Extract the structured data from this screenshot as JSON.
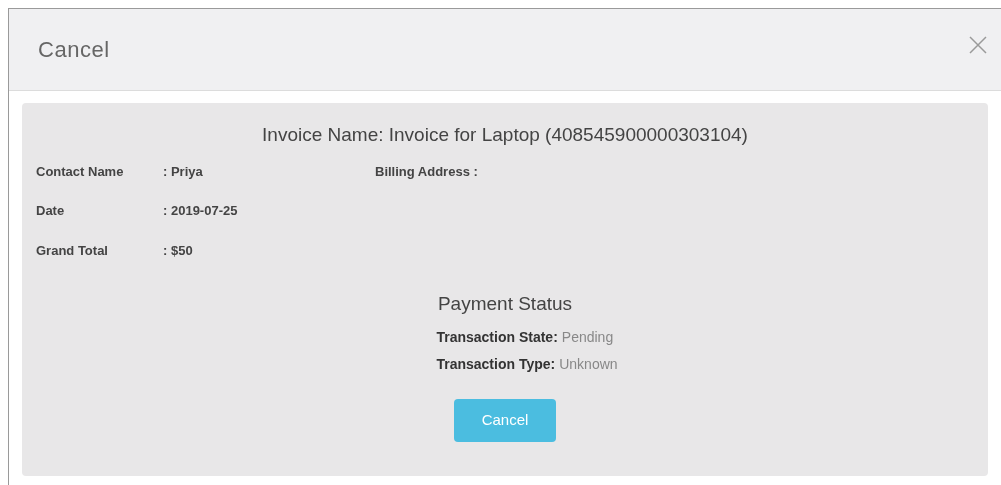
{
  "dialog": {
    "title": "Cancel"
  },
  "invoice": {
    "heading": "Invoice Name: Invoice for Laptop (408545900000303104)",
    "fields": [
      {
        "label": "Contact Name",
        "value": ": Priya"
      },
      {
        "label": "Date",
        "value": ": 2019-07-25"
      },
      {
        "label": "Grand Total",
        "value": ": $50"
      }
    ],
    "billing_label": "Billing Address :"
  },
  "payment": {
    "title": "Payment Status",
    "rows": [
      {
        "label": "Transaction State:",
        "value": "Pending"
      },
      {
        "label": "Transaction Type:",
        "value": "Unknown"
      }
    ]
  },
  "button": "Cancel"
}
